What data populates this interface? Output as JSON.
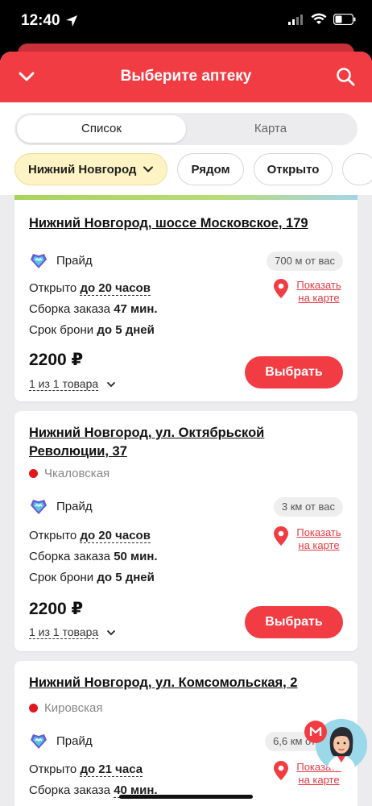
{
  "status_bar": {
    "time": "12:40"
  },
  "header": {
    "title": "Выберите аптеку"
  },
  "view_toggle": {
    "list_label": "Список",
    "map_label": "Карта",
    "active": "list"
  },
  "filters": {
    "city": "Нижний Новгород",
    "nearby": "Рядом",
    "open": "Открыто"
  },
  "pharmacies": [
    {
      "address": "Нижний Новгород, шоссе Московское, 179",
      "metro": "",
      "chain": "Прайд",
      "distance": "700 м от вас",
      "open_prefix": "Открыто ",
      "open_until": "до 20 часов",
      "assembly_prefix": "Сборка заказа ",
      "assembly_time": "47 мин.",
      "reserve_prefix": "Срок брони ",
      "reserve_time": "до 5 дней",
      "price": "2200 ₽",
      "items": "1 из 1 товара",
      "map_link": "Показать на карте",
      "select": "Выбрать"
    },
    {
      "address": "Нижний Новгород, ул. Октябрьской Революции, 37",
      "metro": "Чкаловская",
      "chain": "Прайд",
      "distance": "3 км от вас",
      "open_prefix": "Открыто ",
      "open_until": "до 20 часов",
      "assembly_prefix": "Сборка заказа ",
      "assembly_time": "50 мин.",
      "reserve_prefix": "Срок брони ",
      "reserve_time": "до 5 дней",
      "price": "2200 ₽",
      "items": "1 из 1 товара",
      "map_link": "Показать на карте",
      "select": "Выбрать"
    },
    {
      "address": "Нижний Новгород, ул. Комсомольская, 2",
      "metro": "Кировская",
      "chain": "Прайд",
      "distance": "6,6 км от вас",
      "open_prefix": "Открыто ",
      "open_until": "до 21 часа",
      "assembly_prefix": "Сборка заказа ",
      "assembly_time": "40 мин.",
      "map_link": "Показать на карте"
    }
  ],
  "colors": {
    "brand_red": "#f23c43",
    "city_chip": "#fdf3c4",
    "metro_dot": "#e3161e"
  }
}
